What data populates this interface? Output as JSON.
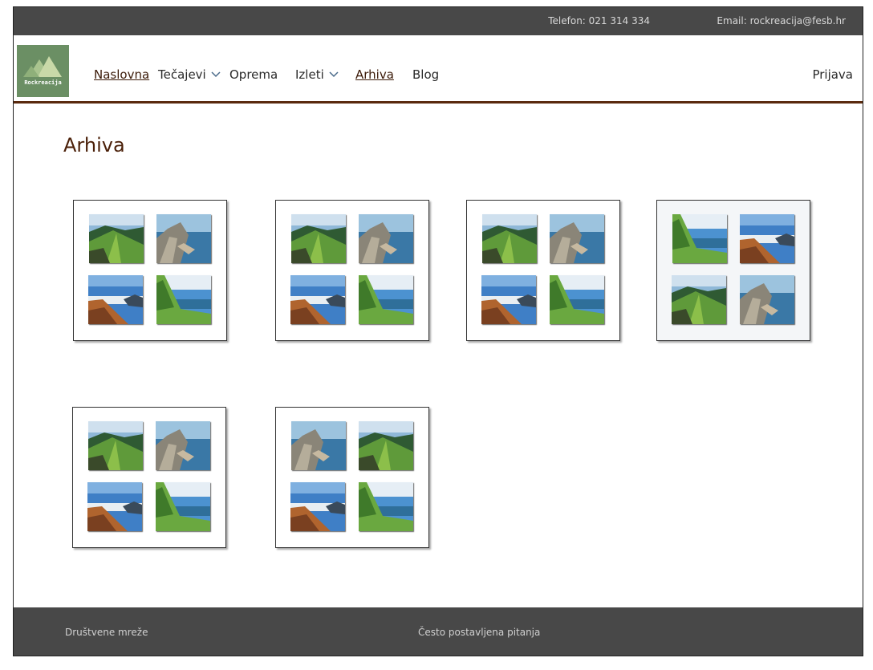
{
  "topbar": {
    "phone": "Telefon: 021 314 334",
    "email": "Email: rockreacija@fesb.hr"
  },
  "logo": {
    "text": "Rockreacija"
  },
  "nav": {
    "items": [
      {
        "label": "Naslovna",
        "underlined": true,
        "dropdown": false
      },
      {
        "label": "Tečajevi",
        "underlined": false,
        "dropdown": true
      },
      {
        "label": "Oprema",
        "underlined": false,
        "dropdown": false
      },
      {
        "label": "Izleti",
        "underlined": false,
        "dropdown": true
      },
      {
        "label": "Arhiva",
        "underlined": true,
        "dropdown": false
      },
      {
        "label": "Blog",
        "underlined": false,
        "dropdown": false
      }
    ],
    "login": "Prijava"
  },
  "page": {
    "title": "Arhiva"
  },
  "gallery": {
    "albums": [
      {
        "photos": [
          "ridge",
          "coast",
          "cliff",
          "hillside"
        ],
        "highlighted": false
      },
      {
        "photos": [
          "ridge",
          "coast",
          "cliff",
          "hillside"
        ],
        "highlighted": false
      },
      {
        "photos": [
          "ridge",
          "coast",
          "cliff",
          "hillside"
        ],
        "highlighted": false
      },
      {
        "photos": [
          "hillside",
          "cliff",
          "ridge",
          "coast"
        ],
        "highlighted": true
      },
      {
        "photos": [
          "ridge",
          "coast",
          "cliff",
          "hillside"
        ],
        "highlighted": false
      },
      {
        "photos": [
          "coast",
          "ridge",
          "cliff",
          "hillside"
        ],
        "highlighted": false
      }
    ]
  },
  "footer": {
    "social": "Društvene mreže",
    "faq": "Često postavljena pitanja"
  },
  "colors": {
    "bar": "#484848",
    "accent_brown": "#5a2a0e",
    "logo_green": "#6b8f64"
  }
}
